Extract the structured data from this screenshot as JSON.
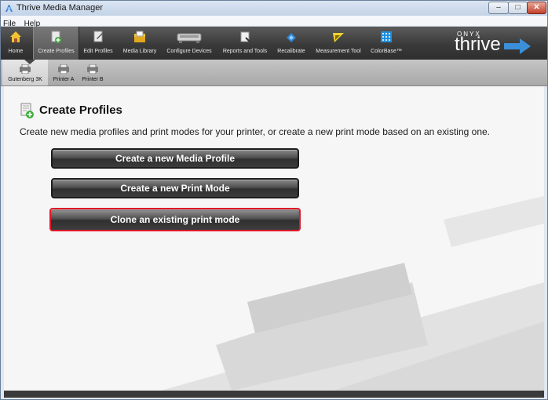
{
  "window": {
    "title": "Thrive Media Manager"
  },
  "menu": [
    "File",
    "Help"
  ],
  "toolbar": [
    {
      "label": "Home",
      "icon": "home-icon",
      "active": false
    },
    {
      "label": "Create Profiles",
      "icon": "create-profiles-icon",
      "active": true
    },
    {
      "label": "Edit Profiles",
      "icon": "edit-profiles-icon",
      "active": false
    },
    {
      "label": "Media Library",
      "icon": "media-library-icon",
      "active": false
    },
    {
      "label": "Configure Devices",
      "icon": "configure-devices-icon",
      "active": false
    },
    {
      "label": "Reports and Tools",
      "icon": "reports-tools-icon",
      "active": false
    },
    {
      "label": "Recalibrate",
      "icon": "recalibrate-icon",
      "active": false
    },
    {
      "label": "Measurement Tool",
      "icon": "measurement-tool-icon",
      "active": false
    },
    {
      "label": "ColorBase™",
      "icon": "colorbase-icon",
      "active": false
    }
  ],
  "logo": {
    "brand": "ONYX",
    "product": "thrive"
  },
  "printers": [
    {
      "label": "Gutenberg 3K",
      "active": true
    },
    {
      "label": "Printer A",
      "active": false
    },
    {
      "label": "Printer B",
      "active": false
    }
  ],
  "main": {
    "title": "Create Profiles",
    "description": "Create new media profiles and print modes for your printer, or create a new print mode based on an existing one.",
    "buttons": {
      "new_media_profile": "Create a new Media Profile",
      "new_print_mode": "Create a new Print Mode",
      "clone_print_mode": "Clone an existing print mode"
    }
  },
  "colors": {
    "toolbar": "#3f3f3f",
    "accent_blue": "#3b8fd9",
    "focus_red": "#e0192a"
  }
}
